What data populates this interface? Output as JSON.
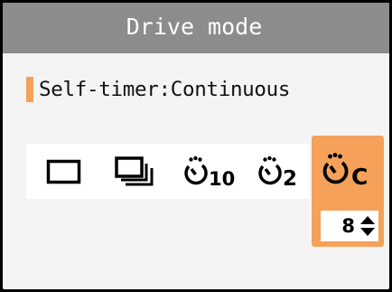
{
  "title": "Drive mode",
  "status_text": "Self-timer:Continuous",
  "modes": [
    {
      "name": "single-shot",
      "label": ""
    },
    {
      "name": "continuous",
      "label": ""
    },
    {
      "name": "self-timer-10",
      "label": "10"
    },
    {
      "name": "self-timer-2",
      "label": "2"
    },
    {
      "name": "self-timer-continuous",
      "label": "C",
      "selected": true
    }
  ],
  "shot_count": "8",
  "colors": {
    "title_bar": "#8c8c8c",
    "accent": "#f5a15a",
    "background": "#f4f4f4"
  }
}
